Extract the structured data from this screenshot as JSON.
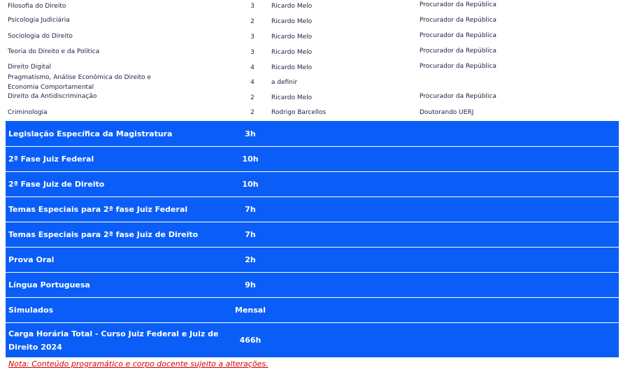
{
  "disciplines": [
    {
      "name": "Filosofia do Direito",
      "hours": "3",
      "professor": "Ricardo Melo",
      "title": "Procurador da República"
    },
    {
      "name": "Psicologia Judiciária",
      "hours": "2",
      "professor": "Ricardo Melo",
      "title": "Procurador da República"
    },
    {
      "name": "Sociologia do Direito",
      "hours": "3",
      "professor": "Ricardo Melo",
      "title": "Procurador da República"
    },
    {
      "name": "Teoria do Direito e da Política",
      "hours": "3",
      "professor": "Ricardo Melo",
      "title": "Procurador da República"
    },
    {
      "name": "Direito Digital",
      "hours": "4",
      "professor": "Ricardo Melo",
      "title": "Procurador da República"
    },
    {
      "name": "Pragmatismo, Análise Econômica do Direito e Economia Comportamental",
      "hours": "4",
      "professor": "a definir",
      "title": ""
    },
    {
      "name": "Direito da Antidiscriminação",
      "hours": "2",
      "professor": "Ricardo Melo",
      "title": "Procurador da República"
    },
    {
      "name": "Criminologia",
      "hours": "2",
      "professor": "Rodrigo Barcellos",
      "title": "Doutorando UERJ"
    }
  ],
  "modules": [
    {
      "label": "Legislação Específica da Magistratura",
      "hours": "3h"
    },
    {
      "label": "2ª Fase Juiz Federal",
      "hours": "10h"
    },
    {
      "label": "2ª Fase Juiz de Direito",
      "hours": "10h"
    },
    {
      "label": "Temas Especiais para 2ª fase Juiz Federal",
      "hours": "7h"
    },
    {
      "label": "Temas Especiais para 2ª fase Juiz de Direito",
      "hours": "7h"
    },
    {
      "label": "Prova Oral",
      "hours": "2h"
    },
    {
      "label": "Língua Portuguesa",
      "hours": "9h"
    },
    {
      "label": "Simulados",
      "hours": "Mensal"
    },
    {
      "label": "Carga Horária Total - Curso Juiz Federal e Juiz de Direito 2024",
      "hours": "466h"
    }
  ],
  "note": "Nota: Conteúdo programático e corpo docente sujeito a alterações.",
  "colors": {
    "module_bg": "#0a5ef7",
    "note": "#d40000"
  }
}
